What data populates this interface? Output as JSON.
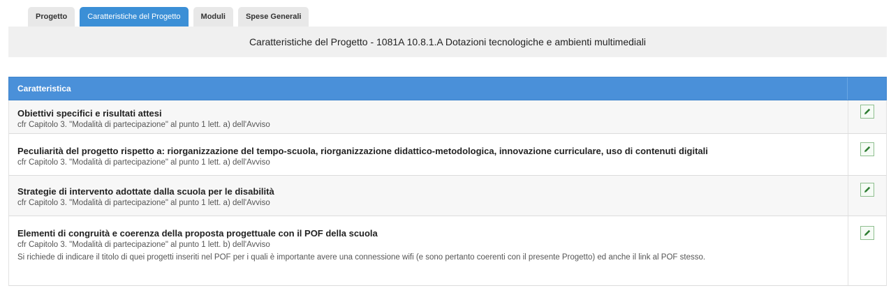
{
  "tabs": [
    {
      "label": "Progetto",
      "active": false
    },
    {
      "label": "Caratteristiche del Progetto",
      "active": true
    },
    {
      "label": "Moduli",
      "active": false
    },
    {
      "label": "Spese Generali",
      "active": false
    }
  ],
  "header": {
    "title": "Caratteristiche del Progetto - 1081A 10.8.1.A Dotazioni tecnologiche e ambienti multimediali"
  },
  "table": {
    "column_header": "Caratteristica",
    "rows": [
      {
        "title": "Obiettivi specifici e risultati attesi",
        "subtitle": "cfr Capitolo 3. \"Modalità di partecipazione\" al punto 1 lett. a) dell'Avviso"
      },
      {
        "title": "Peculiarità del progetto rispetto a: riorganizzazione del tempo-scuola, riorganizzazione didattico-metodologica, innovazione curriculare, uso di contenuti digitali",
        "subtitle": "cfr Capitolo 3. \"Modalità di partecipazione\" al punto 1 lett. a) dell'Avviso"
      },
      {
        "title": "Strategie di intervento adottate dalla scuola per le disabilità",
        "subtitle": "cfr Capitolo 3. \"Modalità di partecipazione\" al punto 1 lett. a) dell'Avviso"
      },
      {
        "title": "Elementi di congruità e coerenza della proposta progettuale con il POF della scuola",
        "subtitle": "cfr Capitolo 3. \"Modalità di partecipazione\" al punto 1 lett. b) dell'Avviso",
        "note": "Si richiede di indicare il titolo di quei progetti inseriti nel POF per i quali è importante avere una connessione wifi (e sono pertanto coerenti con il presente Progetto) ed anche il link al POF stesso."
      }
    ]
  },
  "icons": {
    "edit": "edit-pencil-icon"
  },
  "colors": {
    "accent": "#4a90d9",
    "edit_icon": "#2e7d32"
  }
}
